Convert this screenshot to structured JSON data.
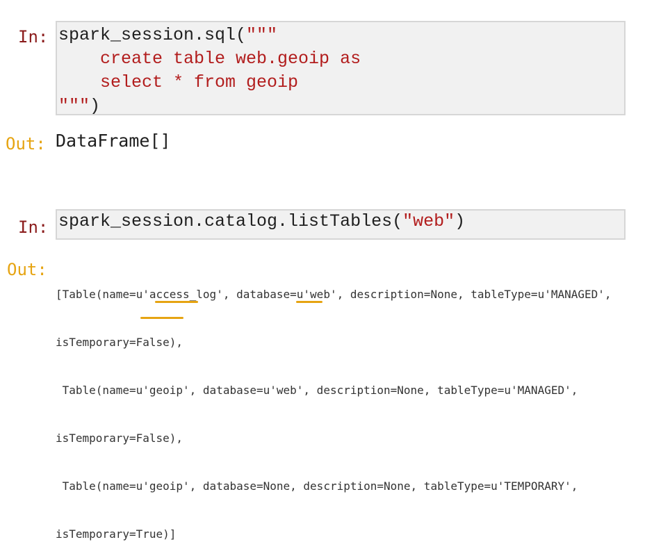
{
  "colors": {
    "in_prompt": "#8b1c1c",
    "out_prompt": "#e6a412",
    "string": "#b21d1d",
    "cell_bg": "#f1f1f1",
    "highlight_underline": "#e6a412"
  },
  "cell1": {
    "in_prompt": "In:",
    "code_prefix": "spark_session.sql(",
    "code_string_open": "\"\"\"",
    "code_string_line2": "    create table web.geoip as",
    "code_string_line3": "    select * from geoip",
    "code_string_close": "\"\"\"",
    "code_suffix": ")",
    "out_prompt": "Out:",
    "out_text": "DataFrame[]"
  },
  "cell2": {
    "in_prompt": "In:",
    "code_prefix": "spark_session.catalog.listTables(",
    "code_string": "\"web\"",
    "code_suffix": ")",
    "out_prompt": "Out:",
    "out_lines": [
      "[Table(name=u'access_log', database=u'web', description=None, tableType=u'MANAGED',",
      "isTemporary=False),",
      " Table(name=u'geoip', database=u'web', description=None, tableType=u'MANAGED',",
      "isTemporary=False),",
      " Table(name=u'geoip', database=None, description=None, tableType=u'TEMPORARY',",
      "isTemporary=True)]"
    ]
  }
}
